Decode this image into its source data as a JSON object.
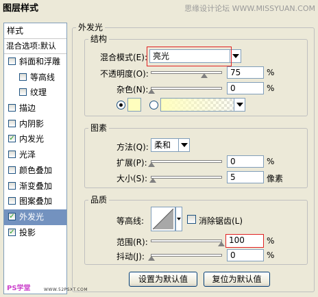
{
  "window": {
    "title": "图层样式",
    "watermark": "思缘设计论坛 WWW.MISSYUAN.COM"
  },
  "styles_list": {
    "header": "样式",
    "blend_options": "混合选项:默认",
    "items": [
      {
        "label": "斜面和浮雕",
        "checked": false,
        "indent": false
      },
      {
        "label": "等高线",
        "checked": false,
        "indent": true
      },
      {
        "label": "纹理",
        "checked": false,
        "indent": true
      },
      {
        "label": "描边",
        "checked": false,
        "indent": false
      },
      {
        "label": "内阴影",
        "checked": false,
        "indent": false
      },
      {
        "label": "内发光",
        "checked": true,
        "indent": false
      },
      {
        "label": "光泽",
        "checked": false,
        "indent": false
      },
      {
        "label": "颜色叠加",
        "checked": false,
        "indent": false
      },
      {
        "label": "渐变叠加",
        "checked": false,
        "indent": false
      },
      {
        "label": "图案叠加",
        "checked": false,
        "indent": false
      },
      {
        "label": "外发光",
        "checked": true,
        "indent": false,
        "selected": true
      },
      {
        "label": "投影",
        "checked": true,
        "indent": false
      }
    ],
    "logo": "PS学堂",
    "logo2": "WWW.52PSXT.COM",
    "check_mark": "✓"
  },
  "panel": {
    "title": "外发光",
    "structure": {
      "title": "结构",
      "blend_mode_label": "混合模式(E):",
      "blend_mode_value": "亮光",
      "opacity_label": "不透明度(O):",
      "opacity_value": "75",
      "opacity_level": 0.75,
      "noise_label": "杂色(N):",
      "noise_value": "0",
      "noise_level": 0,
      "percent": "%",
      "glow_color": "#fffebe"
    },
    "elements": {
      "title": "图素",
      "technique_label": "方法(Q):",
      "technique_value": "柔和",
      "spread_label": "扩展(P):",
      "spread_value": "0",
      "spread_level": 0,
      "size_label": "大小(S):",
      "size_value": "5",
      "size_unit": "像素",
      "size_level": 0.02,
      "percent": "%"
    },
    "quality": {
      "title": "品质",
      "contour_label": "等高线:",
      "antialias_label": "消除锯齿(L)",
      "range_label": "范围(R):",
      "range_value": "100",
      "range_level": 1.0,
      "jitter_label": "抖动(J):",
      "jitter_value": "0",
      "jitter_level": 0,
      "percent": "%"
    },
    "buttons": {
      "make_default": "设置为默认值",
      "reset_default": "复位为默认值"
    }
  }
}
